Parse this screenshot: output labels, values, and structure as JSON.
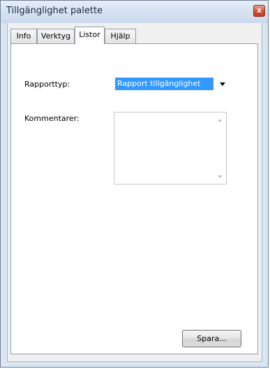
{
  "window": {
    "title": "Tillgänglighet palette",
    "close_glyph": "x"
  },
  "tabs": [
    {
      "label": "Info",
      "active": false
    },
    {
      "label": "Verktyg",
      "active": false
    },
    {
      "label": "Listor",
      "active": true
    },
    {
      "label": "Hjälp",
      "active": false
    }
  ],
  "form": {
    "report_type_label": "Rapporttyp:",
    "report_type_value": "Rapport tillgänglighet",
    "comments_label": "Kommentarer:",
    "comments_value": ""
  },
  "buttons": {
    "save_label": "Spara..."
  },
  "icons": {
    "close": "close-icon",
    "dropdown": "chevron-down-icon",
    "scroll_up": "scroll-up-arrow-icon",
    "scroll_down": "scroll-down-arrow-icon"
  },
  "colors": {
    "selection": "#3399ff",
    "close_button": "#c23d1f"
  }
}
